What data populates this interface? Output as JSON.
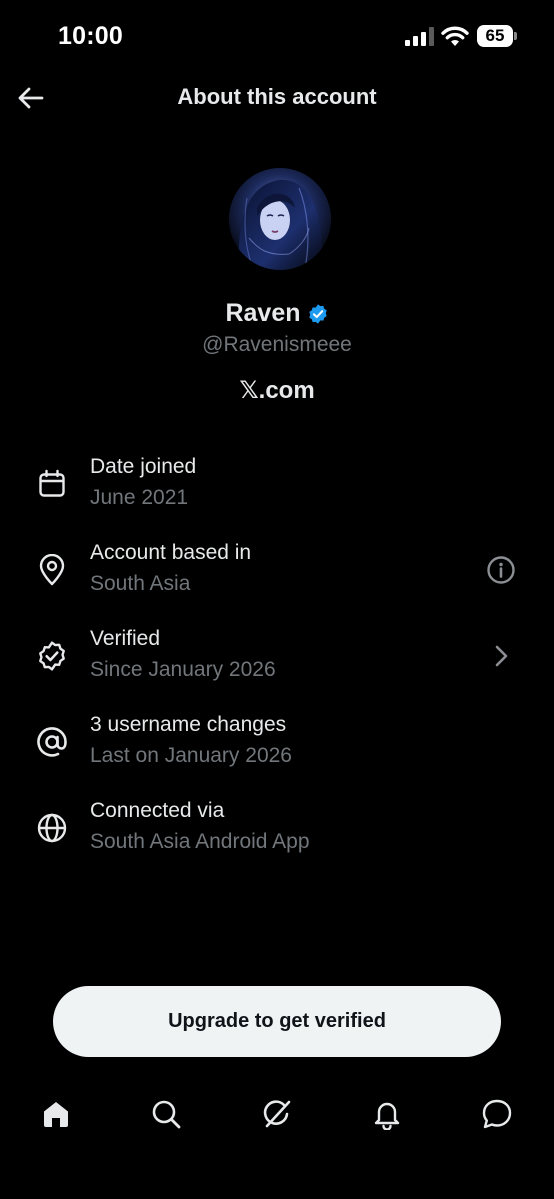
{
  "status_bar": {
    "time": "10:00",
    "battery_level": "65",
    "icons": [
      "cellular-signal-icon",
      "wifi-icon",
      "battery-icon"
    ]
  },
  "header": {
    "title": "About this account",
    "back_icon": "arrow-left-icon"
  },
  "profile": {
    "display_name": "Raven",
    "handle": "@Ravenismeee",
    "site": "𝕏.com",
    "verified_badge_color": "#1d9bf0"
  },
  "info_items": [
    {
      "icon": "calendar-icon",
      "title": "Date joined",
      "subtitle": "June 2021"
    },
    {
      "icon": "location-pin-icon",
      "title": "Account based in",
      "subtitle": "South Asia",
      "action_icon": "info-icon"
    },
    {
      "icon": "verified-seal-icon",
      "title": "Verified",
      "subtitle": "Since January 2026",
      "action_icon": "chevron-right-icon"
    },
    {
      "icon": "at-sign-icon",
      "title": "3 username changes",
      "subtitle": "Last on January 2026"
    },
    {
      "icon": "globe-icon",
      "title": "Connected via",
      "subtitle": "South Asia Android App"
    }
  ],
  "upgrade_button": {
    "label": "Upgrade to get verified"
  },
  "bottom_nav": {
    "items": [
      "home-icon",
      "search-icon",
      "grok-icon",
      "notifications-icon",
      "messages-icon"
    ]
  },
  "colors": {
    "background": "#000000",
    "primary_text": "#e7e9ea",
    "secondary_text": "#71767b",
    "button_background": "#eff3f4"
  }
}
